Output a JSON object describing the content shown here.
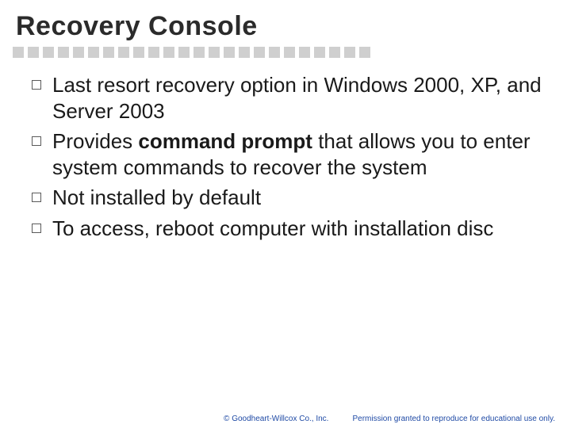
{
  "title": "Recovery Console",
  "bullets": [
    {
      "segments": [
        {
          "text": "Last resort recovery option in Windows 2000, XP, and Server 2003",
          "bold": false
        }
      ]
    },
    {
      "segments": [
        {
          "text": "Provides ",
          "bold": false
        },
        {
          "text": "command prompt",
          "bold": true
        },
        {
          "text": " that allows you to enter system commands to recover the system",
          "bold": false
        }
      ]
    },
    {
      "segments": [
        {
          "text": "Not installed by default",
          "bold": false
        }
      ]
    },
    {
      "segments": [
        {
          "text": "To access, reboot computer with installation disc",
          "bold": false
        }
      ]
    }
  ],
  "footer": {
    "copyright": "© Goodheart-Willcox Co., Inc.",
    "permission": "Permission granted to reproduce for educational use only."
  },
  "divider_count": 24
}
